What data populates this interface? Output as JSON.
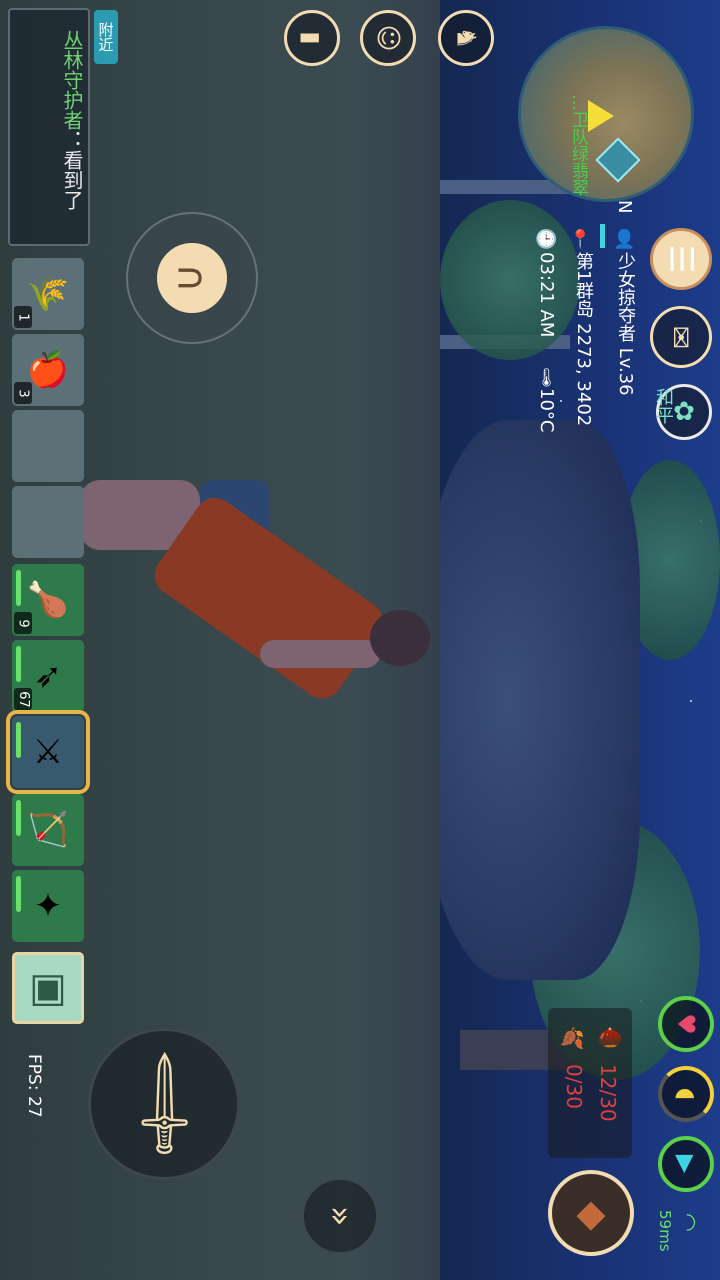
{
  "chat": {
    "tab_label": "附近",
    "speaker": "丛林守护者",
    "message": "：看到了"
  },
  "minimap": {
    "location_label": "…卫队绿翡翠"
  },
  "player": {
    "compass": "N",
    "name": "少女掠夺者 Lv.36",
    "location": "第1群岛 2273, 3402",
    "time": "03:21 AM",
    "temperature": "10°C",
    "pvp_status": "和平"
  },
  "hotbar": [
    {
      "name": "wheat",
      "icon": "🌾",
      "count": "1",
      "style": ""
    },
    {
      "name": "apple",
      "icon": "🍎",
      "count": "3",
      "style": ""
    },
    {
      "name": "empty-1",
      "icon": "",
      "count": "",
      "style": ""
    },
    {
      "name": "empty-2",
      "icon": "",
      "count": "",
      "style": ""
    },
    {
      "name": "drumstick",
      "icon": "🍗",
      "count": "9",
      "style": "green"
    },
    {
      "name": "arrows",
      "icon": "➶",
      "count": "67",
      "style": "green"
    },
    {
      "name": "scimitar",
      "icon": "⚔",
      "count": "",
      "style": "selected"
    },
    {
      "name": "longbow",
      "icon": "🏹",
      "count": "",
      "style": "green"
    },
    {
      "name": "magic-staff",
      "icon": "✦",
      "count": "",
      "style": "green"
    }
  ],
  "fps": "FPS: 27",
  "ammo": {
    "primary": "12/30",
    "secondary": "0/30"
  },
  "network": {
    "ping": "59ms"
  },
  "colors": {
    "ui_cream": "#f3dcb2",
    "health_green": "#5bd14a",
    "ammo_red": "#e04040"
  }
}
